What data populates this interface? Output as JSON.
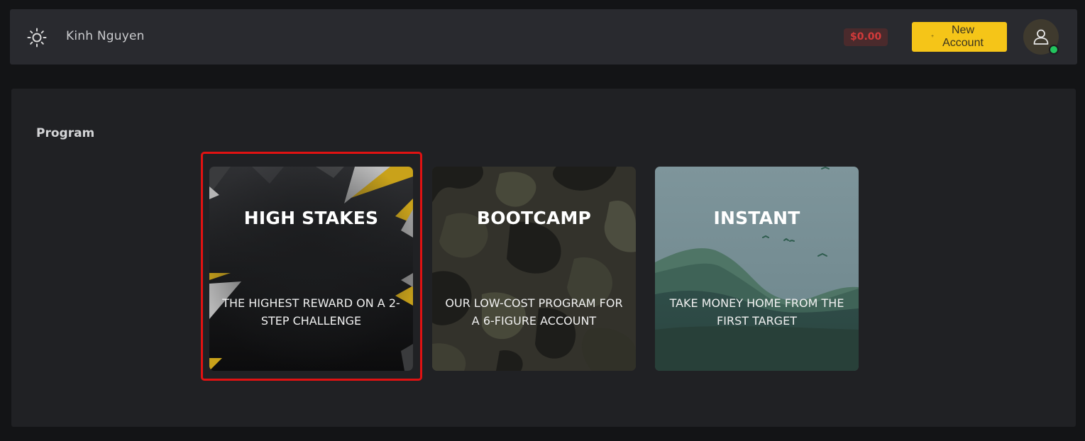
{
  "header": {
    "user_name": "Kinh Nguyen",
    "balance": "$0.00",
    "new_account_label": "New Account"
  },
  "program": {
    "title": "Program",
    "cards": [
      {
        "title": "HIGH STAKES",
        "description": "THE HIGHEST REWARD ON A 2-STEP CHALLENGE",
        "selected": true
      },
      {
        "title": "BOOTCAMP",
        "description": "OUR LOW-COST PROGRAM FOR A 6-FIGURE ACCOUNT",
        "selected": false
      },
      {
        "title": "INSTANT",
        "description": "TAKE MONEY HOME FROM THE FIRST TARGET",
        "selected": false
      }
    ]
  },
  "colors": {
    "accent": "#f5c518",
    "balance_text": "#d23a3a",
    "online": "#22c55e",
    "selection": "#e11212"
  }
}
